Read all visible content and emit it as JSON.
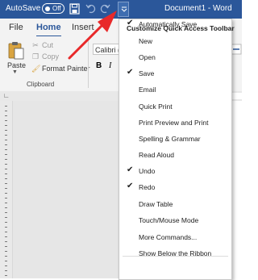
{
  "titlebar": {
    "autosave_label": "AutoSave",
    "autosave_state": "Off",
    "document_title": "Document1  -  Word",
    "icons": [
      "save-icon",
      "undo-icon",
      "redo-icon",
      "customize-qat-icon"
    ]
  },
  "tabs": [
    {
      "label": "File"
    },
    {
      "label": "Home"
    },
    {
      "label": "Insert"
    }
  ],
  "ribbon": {
    "paste_label": "Paste",
    "cut_label": "Cut",
    "copy_label": "Copy",
    "format_painter_label": "Format Painter",
    "group_label": "Clipboard",
    "font_name": "Calibri (B",
    "bold_label": "B",
    "italic_label": "I"
  },
  "menu": {
    "header": "Customize Quick Access Toolbar",
    "items": [
      {
        "label": "Automatically Save",
        "checked": true
      },
      {
        "label": "New",
        "checked": false
      },
      {
        "label": "Open",
        "checked": false
      },
      {
        "label": "Save",
        "checked": true
      },
      {
        "label": "Email",
        "checked": false
      },
      {
        "label": "Quick Print",
        "checked": false
      },
      {
        "label": "Print Preview and Print",
        "checked": false
      },
      {
        "label": "Spelling & Grammar",
        "checked": false
      },
      {
        "label": "Read Aloud",
        "checked": false
      },
      {
        "label": "Undo",
        "checked": true
      },
      {
        "label": "Redo",
        "checked": true
      },
      {
        "label": "Draw Table",
        "checked": false
      },
      {
        "label": "Touch/Mouse Mode",
        "checked": false
      },
      {
        "label": "More Commands...",
        "checked": false
      },
      {
        "label": "Show Below the Ribbon",
        "checked": false
      }
    ]
  },
  "colors": {
    "titlebar": "#2b579a",
    "annotation_arrow": "#e8292a"
  }
}
